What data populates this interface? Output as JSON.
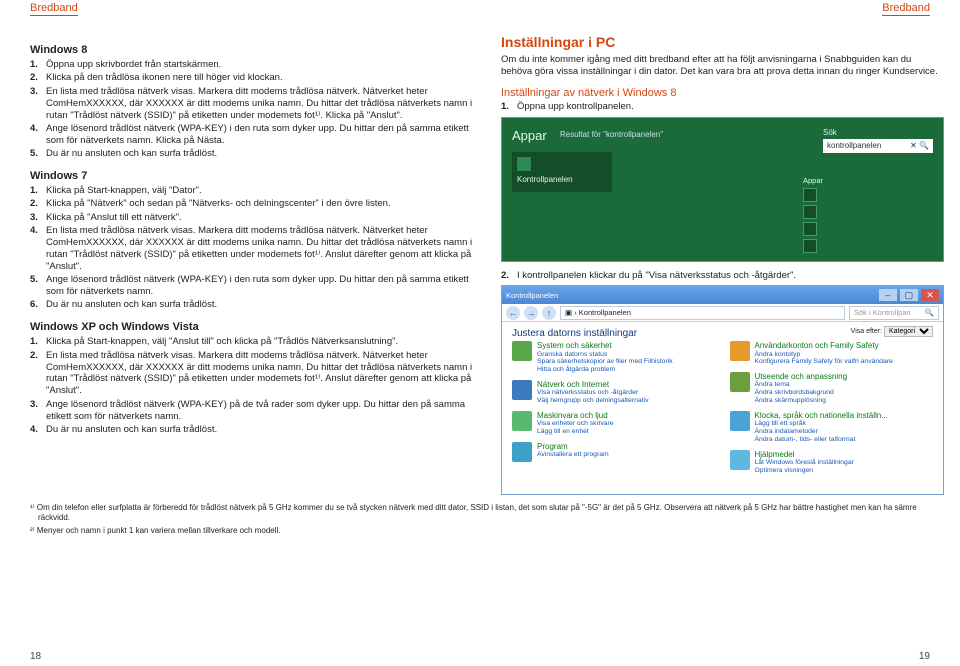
{
  "header": {
    "left": "Bredband",
    "right": "Bredband"
  },
  "pageLeft": "18",
  "pageRight": "19",
  "left": {
    "win8": {
      "title": "Windows 8",
      "items": [
        "Öppna upp skrivbordet från startskärmen.",
        "Klicka på den trådlösa ikonen nere till höger vid klockan.",
        "En lista med trådlösa nätverk visas. Markera ditt modems trådlösa nätverk. Nätverket heter ComHemXXXXXX, där XXXXXX är ditt modems unika namn. Du hittar det trådlösa nätverkets namn i rutan \"Trådlöst nätverk (SSID)\" på etiketten under modemets fot¹⁾. Klicka på \"Anslut\".",
        "Ange lösenord trådlöst nätverk (WPA-KEY) i den ruta som dyker upp. Du hittar den på samma etikett som för nätverkets namn. Klicka på Nästa.",
        "Du är nu ansluten och kan surfa trådlöst."
      ]
    },
    "win7": {
      "title": "Windows 7",
      "items": [
        "Klicka på Start-knappen, välj \"Dator\".",
        "Klicka på \"Nätverk\" och sedan på \"Nätverks- och delningscenter\" i den övre listen.",
        "Klicka på \"Anslut till ett nätverk\".",
        "En lista med trådlösa nätverk visas. Markera ditt modems trådlösa nätverk. Nätverket heter ComHemXXXXXX, där XXXXXX är ditt modems unika namn. Du hittar det trådlösa nätverkets namn i rutan \"Trådlöst nätverk (SSID)\" på etiketten under modemets fot¹⁾. Anslut därefter genom att klicka på \"Anslut\".",
        "Ange lösenord trådlöst nätverk (WPA-KEY) i den ruta som dyker upp. Du hittar den på samma etikett som för nätverkets namn.",
        "Du är nu ansluten och kan surfa trådlöst."
      ]
    },
    "winxp": {
      "title": "Windows XP och Windows Vista",
      "items": [
        "Klicka på Start-knappen, välj \"Anslut till\" och klicka på \"Trådlös Nätverksanslutning\".",
        "En lista med trådlösa nätverk visas. Markera ditt modems trådlösa nätverk. Nätverket heter ComHemXXXXXX, där XXXXXX är ditt modems unika namn. Du hittar det trådlösa nätverkets namn i rutan \"Trådlöst nätverk (SSID)\" på etiketten under modemets fot¹⁾. Anslut därefter genom att klicka på \"Anslut\".",
        "Ange lösenord trådlöst nätverk (WPA-KEY) på de två rader som dyker upp. Du hittar den på samma etikett som för nätverkets namn.",
        "Du är nu ansluten och kan surfa trådlöst."
      ]
    }
  },
  "right": {
    "h2": "Inställningar i PC",
    "intro": "Om du inte kommer igång med ditt bredband efter att ha följt anvisningarna i Snabbguiden kan du behöva göra vissa inställningar i din dator. Det kan vara bra att prova detta innan du ringer Kundservice.",
    "sub": "Inställningar av nätverk i Windows 8",
    "step1": "Öppna upp kontrollpanelen.",
    "shot1": {
      "apps": "Appar",
      "resultsFor": "Resultat för \"kontrollpanelen\"",
      "searchLabel": "Sök",
      "searchValue": "kontrollpanelen",
      "tile": "Kontrollpanelen",
      "appsHeader": "Appar",
      "appList": [
        "",
        "",
        "",
        "",
        ""
      ]
    },
    "step2": "I kontrollpanelen klickar du på \"Visa nätverksstatus och -åtgärder\".",
    "shot2": {
      "title": "Kontrollpanelen",
      "crumb": "Kontrollpanelen",
      "searchPlaceholder": "Sök i Kontrollpan",
      "heading": "Justera datorns inställningar",
      "hint": "",
      "viewLabel": "Visa efter:",
      "viewValue": "Kategori",
      "cats": [
        {
          "t": "System och säkerhet",
          "s": [
            "Granska datorns status",
            "Spara säkerhetskopior av filer med Filhistorik",
            "Hitta och åtgärda problem"
          ]
        },
        {
          "t": "Nätverk och Internet",
          "s": [
            "Visa nätverksstatus och -åtgärder",
            "Välj hemgrupp och delningsalternativ"
          ]
        },
        {
          "t": "Maskinvara och ljud",
          "s": [
            "Visa enheter och skrivare",
            "Lägg till en enhet"
          ]
        },
        {
          "t": "Program",
          "s": [
            "Avinstallera ett program"
          ]
        },
        {
          "t": "Användarkonton och Family Safety",
          "s": [
            "Ändra kontotyp",
            "Konfigurera Family Safety för valfri användare"
          ]
        },
        {
          "t": "Utseende och anpassning",
          "s": [
            "Ändra tema",
            "Ändra skrivbordsbakgrund",
            "Ändra skärmupplösning"
          ]
        },
        {
          "t": "Klocka, språk och nationella inställn...",
          "s": [
            "Lägg till ett språk",
            "Ändra indatametoder",
            "Ändra datum-, tids- eller talformat"
          ]
        },
        {
          "t": "Hjälpmedel",
          "s": [
            "Låt Windows föreslå inställningar",
            "Optimera visningen"
          ]
        }
      ]
    }
  },
  "footnotes": {
    "f1": "¹⁾ Om din telefon eller surfplatta är förberedd för trådlöst nätverk på 5 GHz kommer du se två stycken nätverk med ditt dator, SSID i listan, det som slutar på \"-5G\" är det på 5 GHz. Observera att nätverk på 5 GHz har bättre hastighet men kan ha sämre räckvidd.",
    "f2": "²⁾ Menyer och namn i punkt 1 kan variera mellan tillverkare och modell."
  }
}
